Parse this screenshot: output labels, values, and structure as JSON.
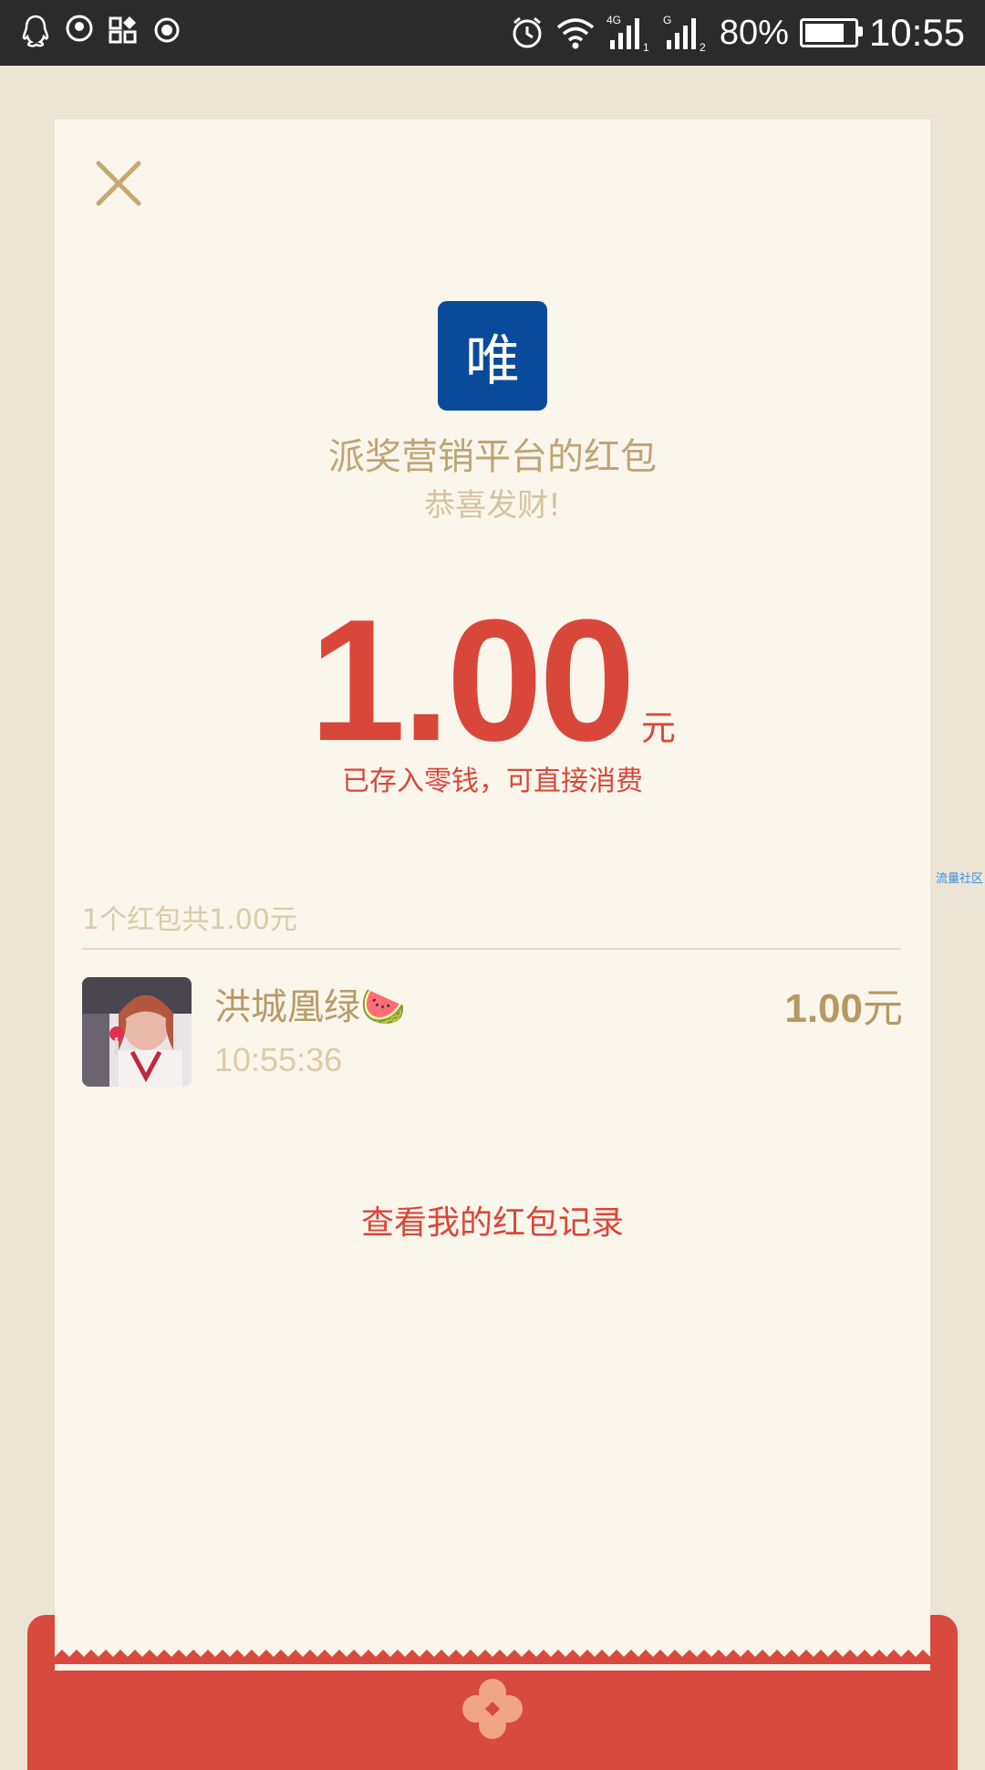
{
  "status_bar": {
    "battery_percent": "80%",
    "battery_level": 0.8,
    "time": "10:55",
    "net1": "4G",
    "net2": "G"
  },
  "card": {
    "logo_char": "唯",
    "sender_title": "派奖营销平台的红包",
    "blessing": "恭喜发财!",
    "amount": "1.00",
    "amount_unit": "元",
    "amount_note": "已存入零钱，可直接消费",
    "summary": "1个红包共1.00元",
    "recipient": {
      "name": "洪城凰绿",
      "name_emoji": "🍉",
      "time": "10:55:36",
      "amount": "1.00",
      "amount_unit": "元"
    },
    "history_link": "查看我的红包记录"
  },
  "watermark": "流量社区",
  "colors": {
    "accent_red": "#d9473a",
    "gold": "#bfa474",
    "logo_blue": "#0a4a9b",
    "envelope_red": "#d84a3e"
  }
}
